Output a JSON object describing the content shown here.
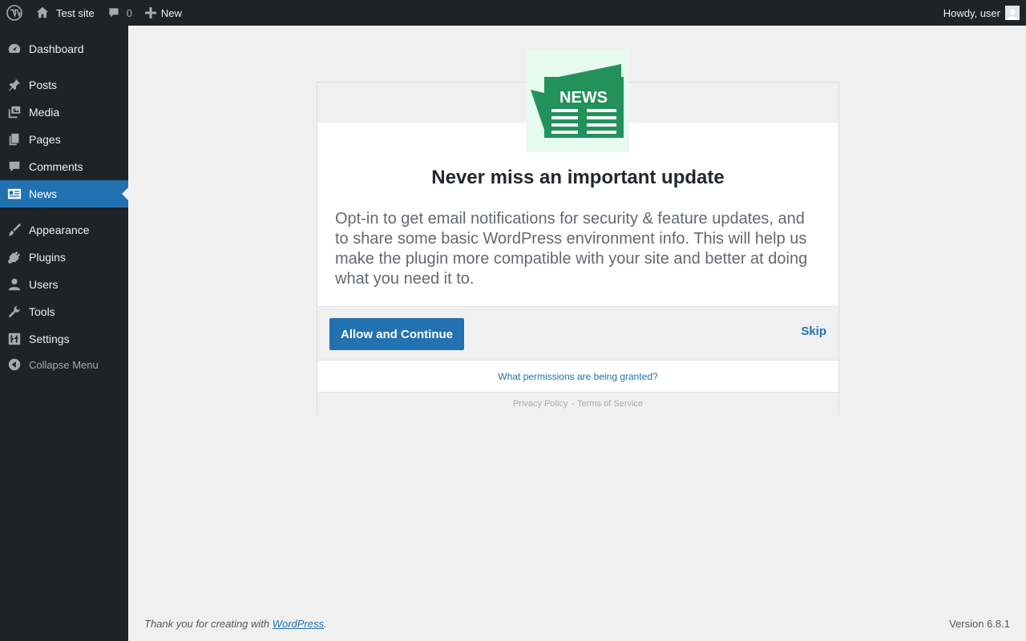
{
  "adminbar": {
    "wp_logo_icon": "wordpress-logo-icon",
    "site_name": "Test site",
    "comments_count": "0",
    "new_label": "New",
    "howdy": "Howdy, user"
  },
  "sidebar": {
    "items": [
      {
        "label": "Dashboard",
        "icon": "dashboard-icon"
      },
      {
        "label": "Posts",
        "icon": "pin-icon"
      },
      {
        "label": "Media",
        "icon": "media-icon"
      },
      {
        "label": "Pages",
        "icon": "pages-icon"
      },
      {
        "label": "Comments",
        "icon": "comments-icon"
      },
      {
        "label": "News",
        "icon": "news-icon"
      },
      {
        "label": "Appearance",
        "icon": "brush-icon"
      },
      {
        "label": "Plugins",
        "icon": "plugin-icon"
      },
      {
        "label": "Users",
        "icon": "user-icon"
      },
      {
        "label": "Tools",
        "icon": "wrench-icon"
      },
      {
        "label": "Settings",
        "icon": "settings-icon"
      }
    ],
    "collapse_label": "Collapse Menu",
    "accent_color": "#2271b1"
  },
  "connect": {
    "plugin_icon_text": "NEWS",
    "heading": "Never miss an important update",
    "body": "Opt-in to get email notifications for security & feature updates, and to share some basic WordPress environment info. This will help us make the plugin more compatible with your site and better at doing what you need it to.",
    "allow_button": "Allow and Continue",
    "skip_button": "Skip",
    "permissions_link": "What permissions are being granted?",
    "privacy_link": "Privacy Policy",
    "separator": "-",
    "terms_link": "Terms of Service"
  },
  "footer": {
    "thanks_prefix": "Thank you for creating with",
    "wordpress_link": "WordPress",
    "thanks_suffix": ".",
    "version": "Version 6.8.1"
  }
}
